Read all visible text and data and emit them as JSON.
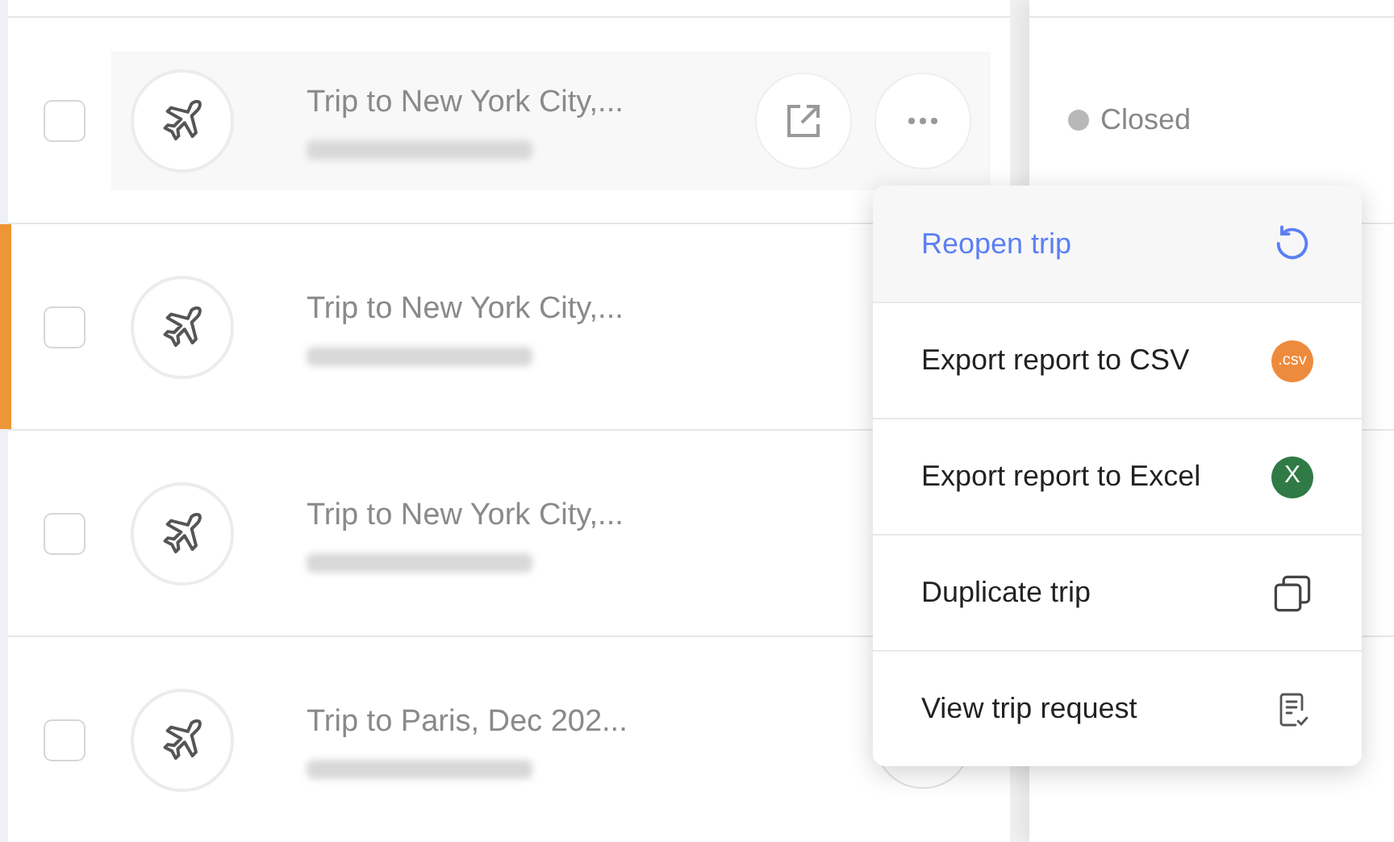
{
  "trips": [
    {
      "title": "Trip to New York City,...",
      "checked": false,
      "hovered": true,
      "flagged": false,
      "status": {
        "label": "Closed",
        "color": "#b8b8b8"
      }
    },
    {
      "title": "Trip to New York City,...",
      "checked": false,
      "hovered": false,
      "flagged": true
    },
    {
      "title": "Trip to New York City,...",
      "checked": false,
      "hovered": false,
      "flagged": false
    },
    {
      "title": "Trip to Paris, Dec 202...",
      "checked": false,
      "hovered": false,
      "flagged": false,
      "menu_open": true
    }
  ],
  "menu": [
    {
      "label": "Reopen trip",
      "kind": "reopen",
      "selected": true
    },
    {
      "label": "Export report to CSV",
      "kind": "csv",
      "badge": ".csv",
      "selected": false
    },
    {
      "label": "Export report to Excel",
      "kind": "excel",
      "badge": "X",
      "selected": false
    },
    {
      "label": "Duplicate trip",
      "kind": "duplicate",
      "selected": false
    },
    {
      "label": "View trip request",
      "kind": "request",
      "selected": false
    }
  ]
}
